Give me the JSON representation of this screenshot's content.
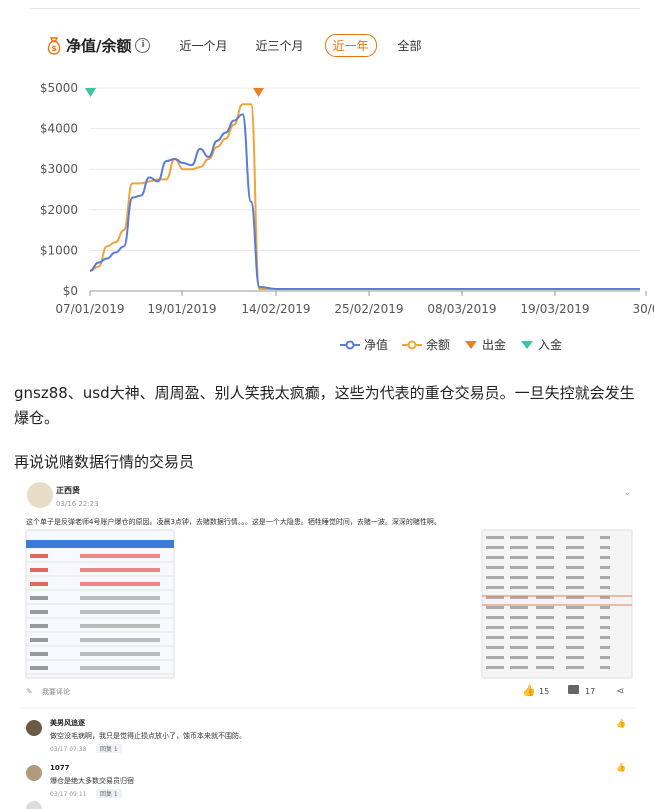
{
  "header": {
    "title": "净值/余额",
    "info_icon": "i"
  },
  "tabs": [
    {
      "label": "近一个月",
      "active": false
    },
    {
      "label": "近三个月",
      "active": false
    },
    {
      "label": "近一年",
      "active": true
    },
    {
      "label": "全部",
      "active": false
    }
  ],
  "legend": [
    {
      "label": "净值",
      "color": "#5b7bd5"
    },
    {
      "label": "余额",
      "color": "#f0a53a"
    },
    {
      "label": "出金",
      "color": "#f07e1e"
    },
    {
      "label": "入金",
      "color": "#3cc4a0"
    }
  ],
  "chart_data": {
    "type": "line",
    "x_ticks": [
      "07/01/2019",
      "19/01/2019",
      "14/02/2019",
      "25/02/2019",
      "08/03/2019",
      "19/03/2019",
      "30/0"
    ],
    "y_ticks": [
      "$5000",
      "$4000",
      "$3000",
      "$2000",
      "$1000",
      "$0"
    ],
    "ylim": [
      0,
      5000
    ],
    "series": [
      {
        "name": "净值",
        "color": "#5b7bd5",
        "values": [
          500,
          700,
          800,
          950,
          1100,
          2300,
          2350,
          2800,
          2700,
          3200,
          3250,
          3150,
          3100,
          3500,
          3300,
          3700,
          3900,
          4200,
          4350,
          2200,
          100,
          50,
          50,
          50,
          50,
          50,
          50,
          50,
          50,
          50,
          50,
          50,
          50,
          50,
          50,
          50
        ]
      },
      {
        "name": "余额",
        "color": "#f0a53a",
        "values": [
          500,
          600,
          1100,
          1200,
          1500,
          2650,
          2650,
          2700,
          2750,
          2750,
          3250,
          3000,
          3000,
          3050,
          3250,
          3550,
          3750,
          4100,
          4600,
          4600,
          50,
          50,
          50,
          50,
          50,
          50,
          50,
          50,
          50,
          50,
          50,
          50,
          50,
          50,
          50,
          50
        ]
      }
    ],
    "markers": [
      {
        "type": "入金",
        "at": "07/01/2019"
      },
      {
        "type": "出金",
        "at": "14/02/2019"
      }
    ]
  },
  "para1": "gnsz88、usd大神、周周盈、别人笑我太疯癫，这些为代表的重仓交易员。一旦失控就会发生爆仓。",
  "para2": "再说说赌数据行情的交易员",
  "post": {
    "author": "正西贤",
    "time": "03/16 22:23",
    "text": "这个单子是反弹老师4号账户爆仓的原因。凌晨3点钟，去赌数据行情。。。这是一个大隐患。牺牲睡觉时间，去赌一波。深深的赌性啊。",
    "comment_prompt": "我要评论",
    "likes": "15",
    "comments": "17",
    "replies": [
      {
        "name": "美男风追逐",
        "text": "做空没毛病啊，我只是觉得止损点放小了，蚀币本来就不围防。",
        "time": "03/17 07:38",
        "reply": "回复 1"
      },
      {
        "name": "1077",
        "text": "爆仓是绝大多数交易员归宿",
        "time": "03/17 09:11",
        "reply": "回复 1"
      }
    ]
  }
}
